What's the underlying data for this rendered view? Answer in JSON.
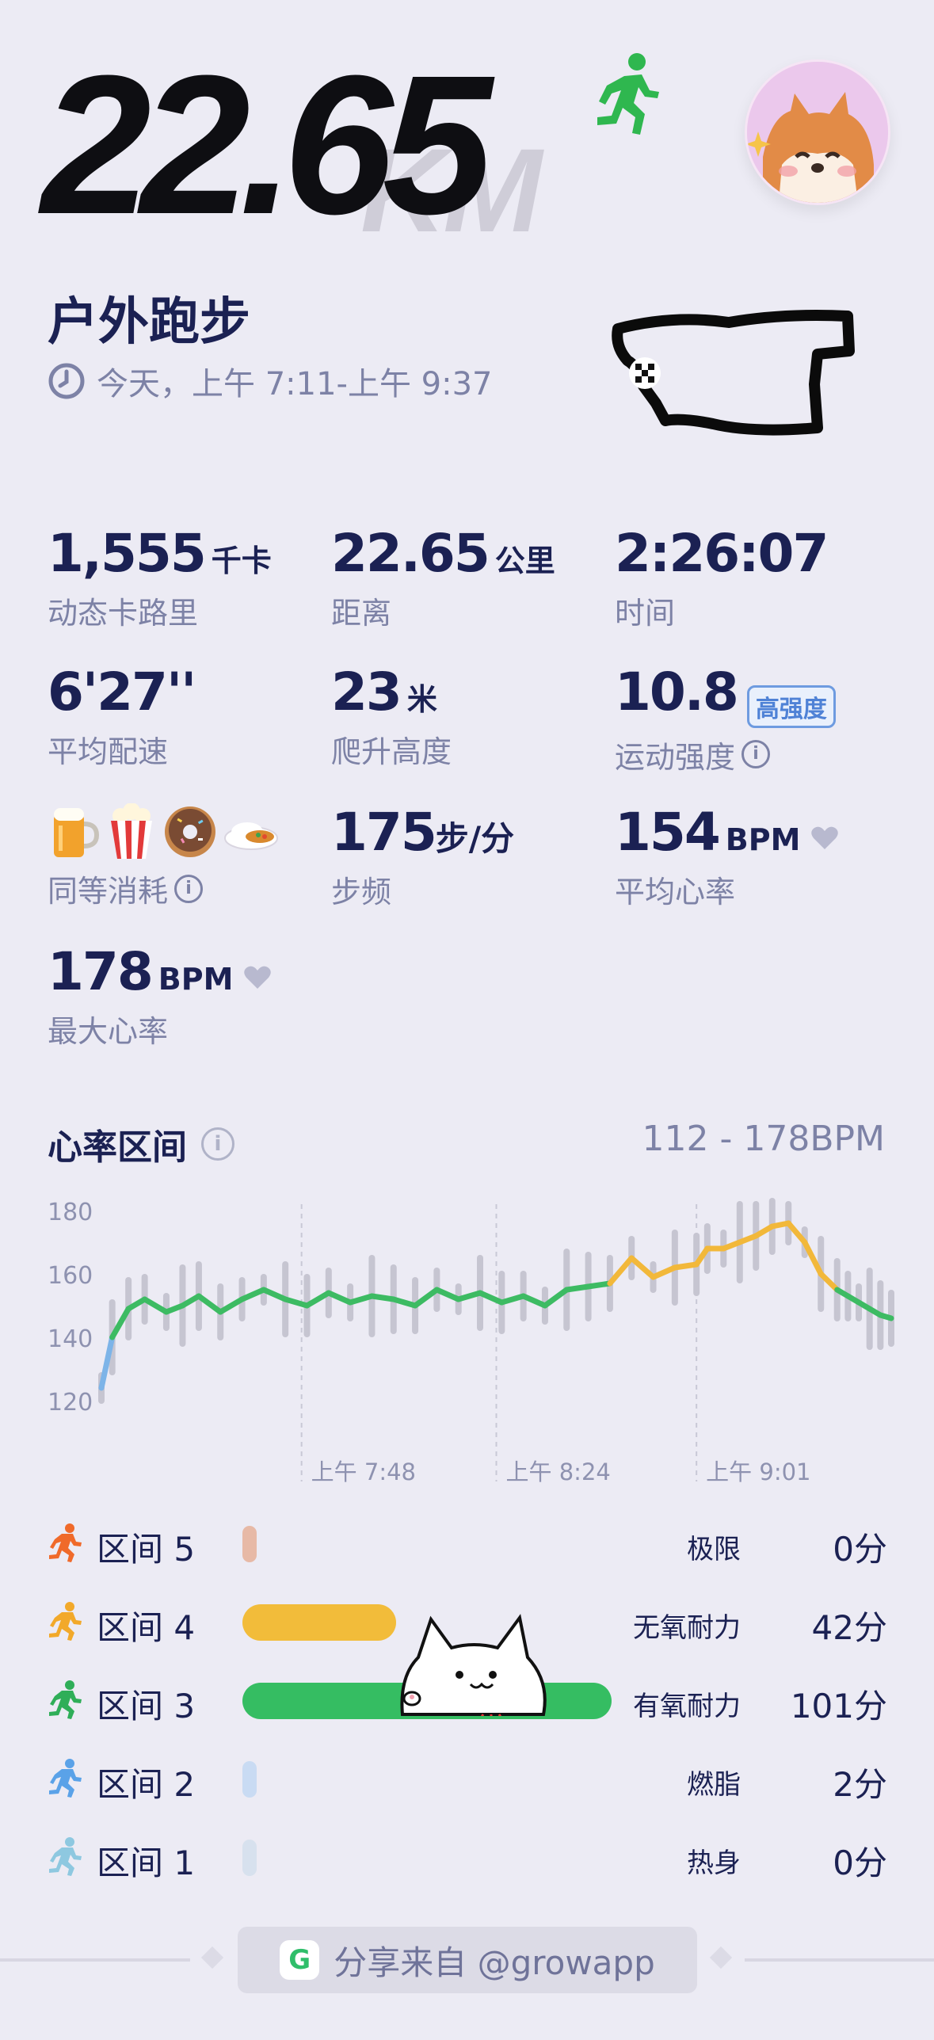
{
  "header": {
    "distance": "22.65",
    "unit_watermark": "KM"
  },
  "workout": {
    "title": "户外跑步",
    "time_range": "今天，上午 7:11-上午 9:37"
  },
  "metrics": [
    {
      "value": "1,555",
      "unit": "千卡",
      "label": "动态卡路里"
    },
    {
      "value": "22.65",
      "unit": "公里",
      "label": "距离"
    },
    {
      "value": "2:26:07",
      "unit": "",
      "label": "时间"
    },
    {
      "value": "6'27''",
      "unit": "",
      "label": "平均配速"
    },
    {
      "value": "23",
      "unit": "米",
      "label": "爬升高度"
    },
    {
      "value": "10.8",
      "unit": "",
      "badge": "高强度",
      "label": "运动强度"
    },
    {
      "value": "",
      "unit": "",
      "label": "同等消耗"
    },
    {
      "value": "175",
      "unit": "步/分",
      "label": "步频"
    },
    {
      "value": "154",
      "unit": "BPM",
      "label": "平均心率"
    },
    {
      "value": "178",
      "unit": "BPM",
      "label": "最大心率"
    }
  ],
  "food_icons": [
    "beer",
    "popcorn",
    "donut",
    "rice"
  ],
  "heart_rate": {
    "title": "心率区间",
    "range": "112 - 178BPM"
  },
  "chart_data": {
    "type": "line",
    "y_ticks": [
      "180",
      "160",
      "140",
      "120"
    ],
    "ylim": [
      112,
      182
    ],
    "x_ticks": [
      "上午 7:48",
      "上午 8:24",
      "上午 9:01"
    ],
    "x_range_minutes": [
      0,
      146
    ],
    "series": [
      {
        "x": [
          0,
          2,
          5,
          8,
          12,
          15,
          18,
          22,
          26,
          30,
          34,
          38,
          42,
          46,
          50,
          54,
          58,
          62,
          66,
          70,
          74,
          78,
          82,
          86,
          90,
          94,
          98,
          102,
          106,
          110,
          112,
          115,
          118,
          121,
          124,
          127,
          130,
          133,
          136,
          138,
          140,
          142,
          144,
          146
        ],
        "values": [
          124,
          140,
          149,
          152,
          148,
          150,
          153,
          148,
          152,
          155,
          152,
          150,
          154,
          151,
          153,
          152,
          150,
          155,
          152,
          154,
          151,
          153,
          150,
          155,
          156,
          157,
          165,
          159,
          162,
          163,
          168,
          168,
          170,
          172,
          175,
          176,
          170,
          160,
          155,
          153,
          151,
          149,
          147,
          146
        ]
      }
    ],
    "zone_colors": {
      "blue": "#7DB4E8",
      "green": "#3DBB63",
      "yellow": "#F2B83A"
    }
  },
  "zones": [
    {
      "label": "区间 5",
      "name": "极限",
      "time": "0分",
      "minutes": 0,
      "color": "#E7B9A6",
      "icon_color": "#F06A2A"
    },
    {
      "label": "区间 4",
      "name": "无氧耐力",
      "time": "42分",
      "minutes": 42,
      "color": "#F2BC3A",
      "icon_color": "#F2A92A"
    },
    {
      "label": "区间 3",
      "name": "有氧耐力",
      "time": "101分",
      "minutes": 101,
      "color": "#35BD62",
      "icon_color": "#2FAE58"
    },
    {
      "label": "区间 2",
      "name": "燃脂",
      "time": "2分",
      "minutes": 2,
      "color": "#C9DBF3",
      "icon_color": "#5AA2E8"
    },
    {
      "label": "区间 1",
      "name": "热身",
      "time": "0分",
      "minutes": 0,
      "color": "#D7E1EE",
      "icon_color": "#8EC8E0"
    }
  ],
  "footer": {
    "share_text": "分享来自 @growapp"
  }
}
